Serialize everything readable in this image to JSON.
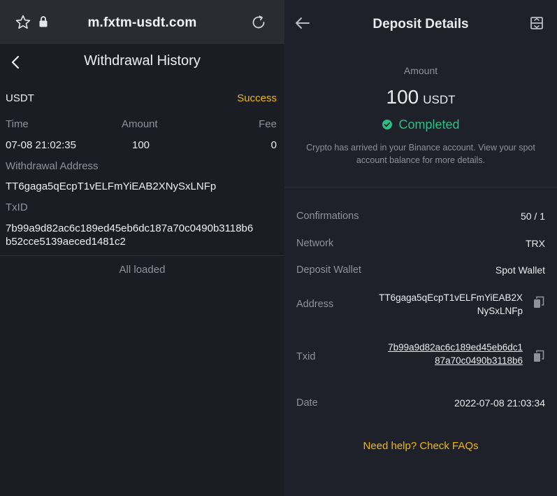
{
  "left": {
    "browser": {
      "url": "m.fxtm-usdt.com",
      "icons": [
        "star-icon",
        "lock-icon",
        "reload-icon"
      ]
    },
    "header": {
      "title": "Withdrawal History",
      "back_icon": "chevron-left-icon"
    },
    "record": {
      "coin": "USDT",
      "status": "Success",
      "col_time": "Time",
      "col_amount": "Amount",
      "col_fee": "Fee",
      "time": "07-08 21:02:35",
      "amount": "100",
      "fee": "0",
      "address_label": "Withdrawal Address",
      "address": "TT6gaga5qEcpT1vELFmYiEAB2XNySxLNFp",
      "txid_label": "TxID",
      "txid_line1": "7b99a9d82ac6c189ed45eb6dc187a70c0490b3118b6",
      "txid_line2": "b52cce5139aeced1481c2"
    },
    "footer": "All loaded"
  },
  "right": {
    "header": {
      "title": "Deposit Details",
      "back_icon": "arrow-left-icon",
      "share_icon": "share-icon"
    },
    "amount_label": "Amount",
    "amount": "100",
    "amount_unit": "USDT",
    "status": "Completed",
    "note_line1": "Crypto has arrived in your Binance account. View your spot",
    "note_line2": "account balance for more details.",
    "details": {
      "confirmations_label": "Confirmations",
      "confirmations": "50 / 1",
      "network_label": "Network",
      "network": "TRX",
      "wallet_label": "Deposit Wallet",
      "wallet": "Spot Wallet",
      "address_label": "Address",
      "address_line1": "TT6gaga5qEcpT1vELFmYiEAB2X",
      "address_line2": "NySxLNFp",
      "txid_label": "Txid",
      "txid_line1": "7b99a9d82ac6c189ed45eb6dc1",
      "txid_line2": "87a70c0490b3118b6",
      "date_label": "Date",
      "date": "2022-07-08 21:03:34"
    },
    "faq": "Need help? Check FAQs",
    "colors": {
      "gold": "#f0b90b",
      "green": "#2ebd85",
      "bg": "#1e2129"
    }
  }
}
